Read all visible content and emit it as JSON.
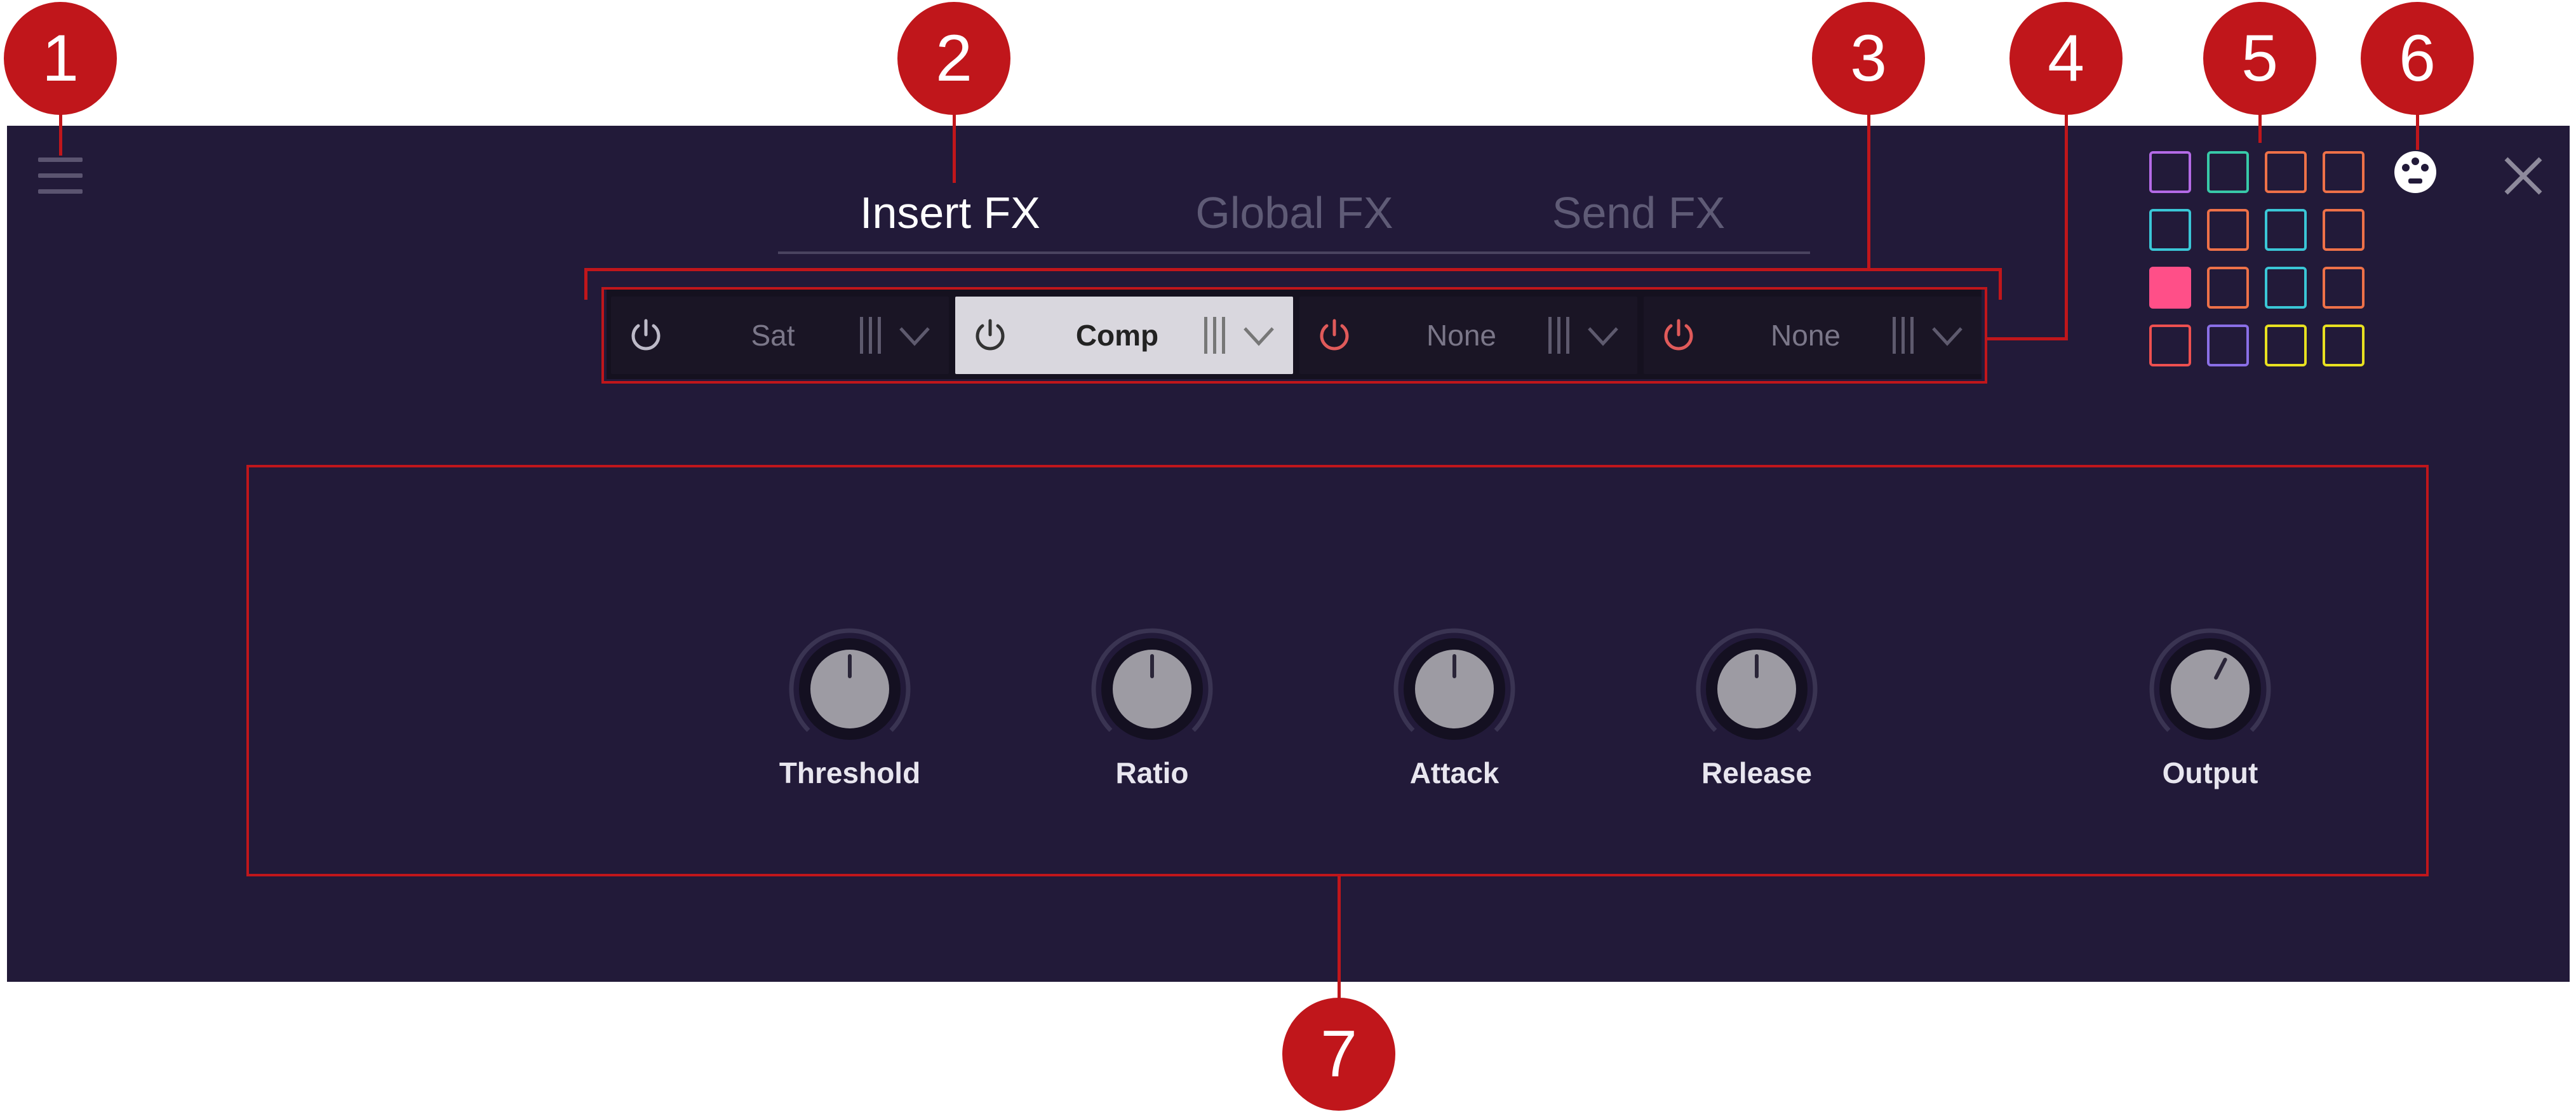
{
  "tabs": [
    {
      "label": "Insert FX",
      "active": true
    },
    {
      "label": "Global FX",
      "active": false
    },
    {
      "label": "Send FX",
      "active": false
    }
  ],
  "slots": [
    {
      "name": "Sat",
      "power": "on",
      "active": false
    },
    {
      "name": "Comp",
      "power": "on",
      "active": true
    },
    {
      "name": "None",
      "power": "off",
      "active": false
    },
    {
      "name": "None",
      "power": "off",
      "active": false
    }
  ],
  "knobs": [
    {
      "label": "Threshold",
      "value": 0.5
    },
    {
      "label": "Ratio",
      "value": 0.5
    },
    {
      "label": "Attack",
      "value": 0.5
    },
    {
      "label": "Release",
      "value": 0.5
    },
    {
      "label": "Output",
      "value": 0.6
    }
  ],
  "color_grid": [
    [
      "#b46ae6",
      "#38c9a8",
      "#ee7148",
      "#ee7148"
    ],
    [
      "#3ac6d6",
      "#ee7148",
      "#3ac6d6",
      "#ee7148"
    ],
    [
      "#ff4f88",
      "#ee7148",
      "#3ac6d6",
      "#ee7148"
    ],
    [
      "#ee5050",
      "#8a6fe6",
      "#e8e020",
      "#e8e020"
    ]
  ],
  "color_grid_selected": [
    2,
    0
  ],
  "annotations": [
    "1",
    "2",
    "3",
    "4",
    "5",
    "6",
    "7"
  ],
  "colors": {
    "panel_bg": "#221a39",
    "accent_red": "#c0161b",
    "power_off": "#e05a5a",
    "text_active": "#ffffff",
    "text_inactive": "#5f5b76"
  },
  "icons": {
    "menu": "hamburger-icon",
    "theme": "theme-icon",
    "close": "close-icon",
    "power": "power-icon",
    "drag": "drag-handle-icon",
    "dropdown": "chevron-down-icon"
  }
}
